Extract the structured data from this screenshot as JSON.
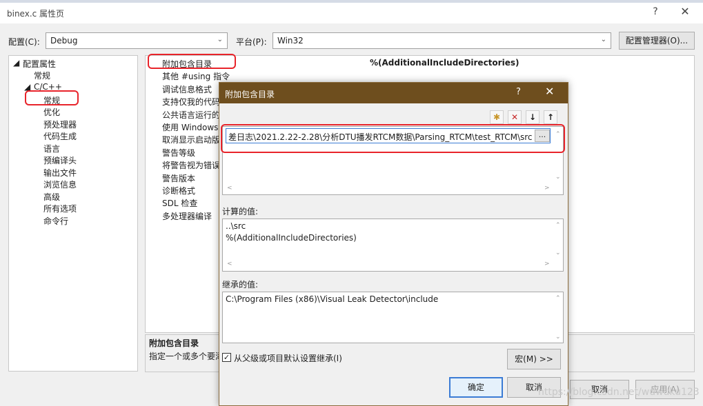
{
  "window": {
    "title": "binex.c 属性页",
    "help": "?",
    "close": "✕"
  },
  "config_bar": {
    "config_label": "配置(C):",
    "config_value": "Debug",
    "platform_label": "平台(P):",
    "platform_value": "Win32",
    "manager_button": "配置管理器(O)..."
  },
  "tree": {
    "items": [
      {
        "label": "配置属性",
        "glyph": "◢"
      },
      {
        "label": "常规"
      },
      {
        "label": "C/C++",
        "glyph": "◢"
      },
      {
        "label": "常规"
      },
      {
        "label": "优化"
      },
      {
        "label": "预处理器"
      },
      {
        "label": "代码生成"
      },
      {
        "label": "语言"
      },
      {
        "label": "预编译头"
      },
      {
        "label": "输出文件"
      },
      {
        "label": "浏览信息"
      },
      {
        "label": "高级"
      },
      {
        "label": "所有选项"
      },
      {
        "label": "命令行"
      }
    ]
  },
  "grid": {
    "properties": [
      "附加包含目录",
      "其他 #using 指令",
      "调试信息格式",
      "支持仅我的代码",
      "公共语言运行的",
      "使用 Windows",
      "取消显示启动版",
      "警告等级",
      "将警告视为错误",
      "警告版本",
      "诊断格式",
      "SDL 检查",
      "多处理器编译"
    ],
    "selected_value": "%(AdditionalIncludeDirectories)"
  },
  "description": {
    "title": "附加包含目录",
    "text": "指定一个或多个要添"
  },
  "dialog": {
    "title": "附加包含目录",
    "help": "?",
    "close": "✕",
    "toolbar": {
      "new_folder_icon": "✱",
      "delete_icon": "✕",
      "down_icon": "↓",
      "up_icon": "↑"
    },
    "entry_value": "差日志\\2021.2.22-2.28\\分析DTU播发RTCM数据\\Parsing_RTCM\\test_RTCM\\src",
    "ellipsis": "...",
    "computed_label": "计算的值:",
    "computed_values": [
      "..\\src",
      "%(AdditionalIncludeDirectories)"
    ],
    "inherited_label": "继承的值:",
    "inherited_values": [
      "C:\\Program Files (x86)\\Visual Leak Detector\\include"
    ],
    "inherit_checkbox_label": "从父级或项目默认设置继承(I)",
    "inherit_checked": true,
    "macros_button": "宏(M) >>",
    "ok_button": "确定",
    "cancel_button": "取消"
  },
  "background_buttons": {
    "cancel": "取消",
    "apply": "应用(A)"
  },
  "watermark": "https://blog.csdn.net/wuwuku123",
  "colors": {
    "dialog_title_bar": "#6e4e1e",
    "highlight_border": "#e8232a",
    "focus_border": "#3a7bd5"
  }
}
